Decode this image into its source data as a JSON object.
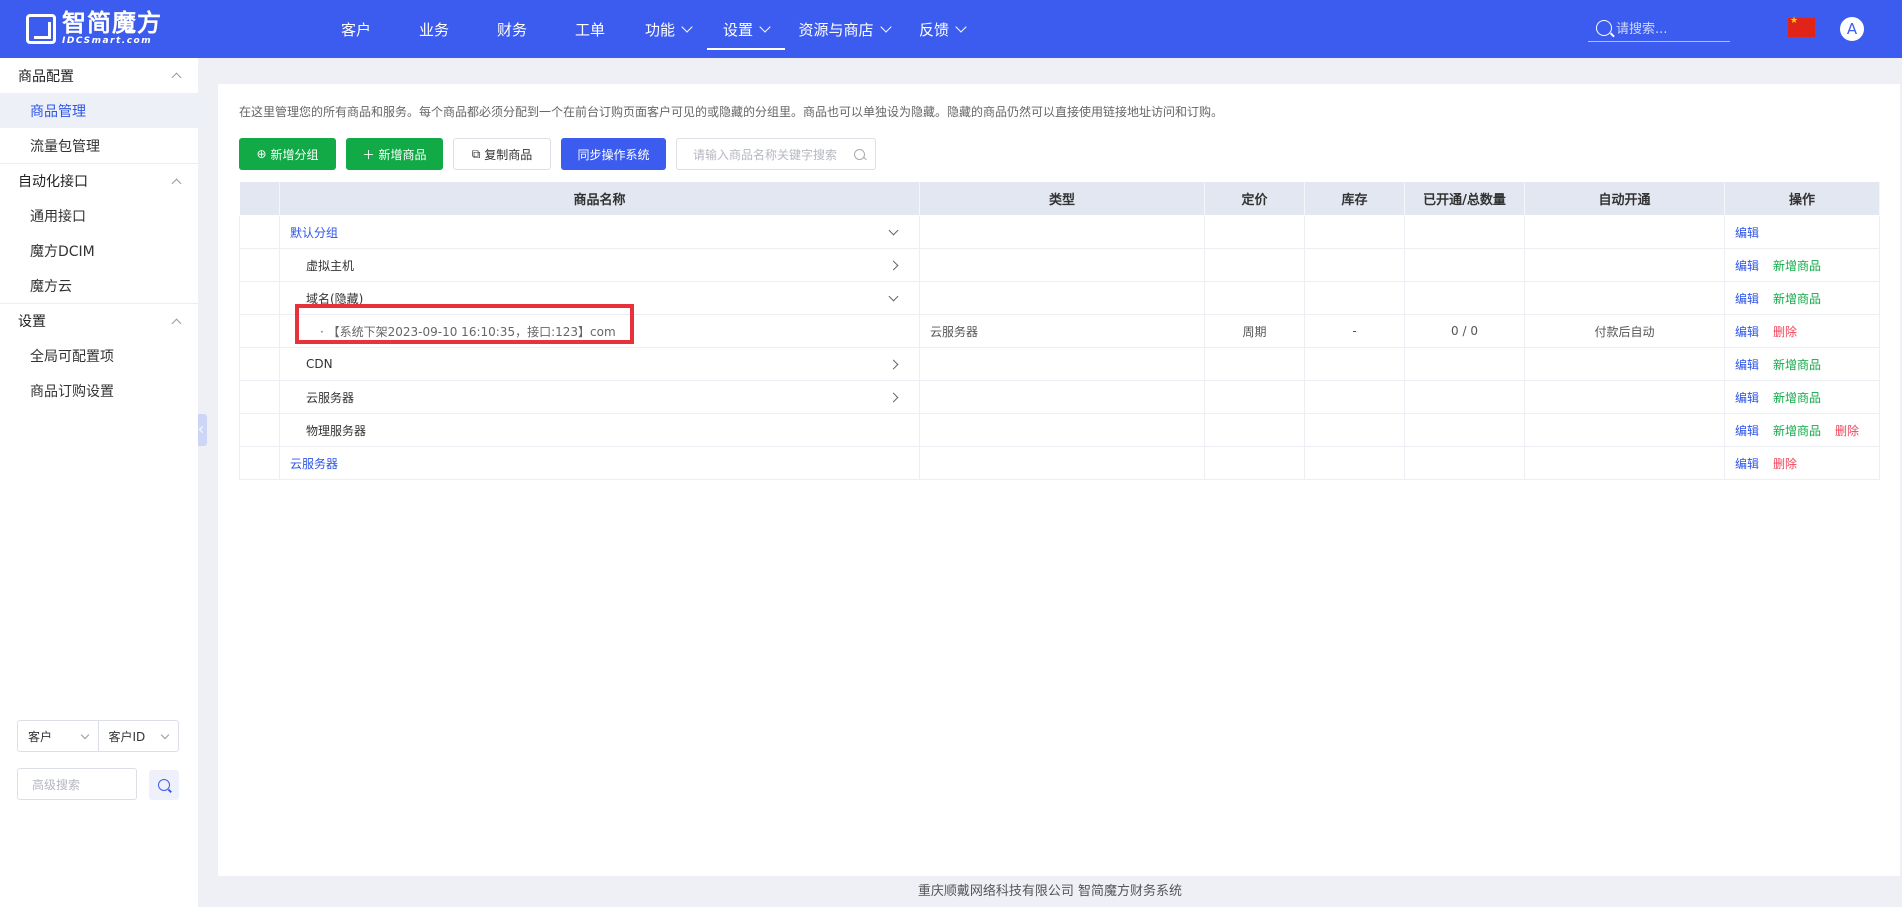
{
  "brand": {
    "name_cn": "智简魔方",
    "name_en": "IDCSmart.com"
  },
  "nav": [
    {
      "label": "客户",
      "has_menu": false,
      "active": false
    },
    {
      "label": "业务",
      "has_menu": false,
      "active": false
    },
    {
      "label": "财务",
      "has_menu": false,
      "active": false
    },
    {
      "label": "工单",
      "has_menu": false,
      "active": false
    },
    {
      "label": "功能",
      "has_menu": true,
      "active": false
    },
    {
      "label": "设置",
      "has_menu": true,
      "active": true
    },
    {
      "label": "资源与商店",
      "has_menu": true,
      "active": false
    },
    {
      "label": "反馈",
      "has_menu": true,
      "active": false
    }
  ],
  "header": {
    "search_placeholder": "请搜索...",
    "avatar_letter": "A",
    "flag": "cn-flag"
  },
  "sidebar": {
    "groups": [
      {
        "title": "商品配置",
        "items": [
          {
            "label": "商品管理",
            "active": true
          },
          {
            "label": "流量包管理",
            "active": false
          }
        ]
      },
      {
        "title": "自动化接口",
        "items": [
          {
            "label": "通用接口",
            "active": false
          },
          {
            "label": "魔方DCIM",
            "active": false
          },
          {
            "label": "魔方云",
            "active": false
          }
        ]
      },
      {
        "title": "设置",
        "items": [
          {
            "label": "全局可配置项",
            "active": false
          },
          {
            "label": "商品订购设置",
            "active": false
          }
        ]
      }
    ],
    "filter_select_1": "客户",
    "filter_select_2": "客户ID",
    "advanced_search_placeholder": "高级搜索"
  },
  "main": {
    "description": "在这里管理您的所有商品和服务。每个商品都必须分配到一个在前台订购页面客户可见的或隐藏的分组里。商品也可以单独设为隐藏。隐藏的商品仍然可以直接使用链接地址访问和订购。",
    "buttons": {
      "add_group": "新增分组",
      "add_product": "新增商品",
      "copy_product": "复制商品",
      "sync_os": "同步操作系统"
    },
    "search_placeholder": "请输入商品名称关键字搜索",
    "columns": [
      "商品名称",
      "类型",
      "定价",
      "库存",
      "已开通/总数量",
      "自动开通",
      "操作"
    ],
    "rows": [
      {
        "name": "默认分组",
        "level": 0,
        "style": "group",
        "arrow": "down",
        "type": "",
        "price": "",
        "stock": "",
        "count": "",
        "auto": "",
        "ops": [
          "编辑"
        ]
      },
      {
        "name": "虚拟主机",
        "level": 1,
        "style": "sub",
        "arrow": "right",
        "type": "",
        "price": "",
        "stock": "",
        "count": "",
        "auto": "",
        "ops": [
          "编辑",
          "新增商品"
        ]
      },
      {
        "name": "域名(隐藏)",
        "level": 1,
        "style": "sub",
        "arrow": "down",
        "type": "",
        "price": "",
        "stock": "",
        "count": "",
        "auto": "",
        "ops": [
          "编辑",
          "新增商品"
        ]
      },
      {
        "name": "· 【系统下架2023-09-10 16:10:35，接口:123】com",
        "level": 2,
        "style": "product",
        "arrow": "",
        "type": "云服务器",
        "price": "周期",
        "stock": "-",
        "count": "0 / 0",
        "auto": "付款后自动",
        "ops": [
          "编辑",
          "删除"
        ]
      },
      {
        "name": "CDN",
        "level": 1,
        "style": "sub",
        "arrow": "right",
        "type": "",
        "price": "",
        "stock": "",
        "count": "",
        "auto": "",
        "ops": [
          "编辑",
          "新增商品"
        ]
      },
      {
        "name": "云服务器",
        "level": 1,
        "style": "sub",
        "arrow": "right",
        "type": "",
        "price": "",
        "stock": "",
        "count": "",
        "auto": "",
        "ops": [
          "编辑",
          "新增商品"
        ]
      },
      {
        "name": "物理服务器",
        "level": 1,
        "style": "sub",
        "arrow": "",
        "type": "",
        "price": "",
        "stock": "",
        "count": "",
        "auto": "",
        "ops": [
          "编辑",
          "新增商品",
          "删除"
        ]
      },
      {
        "name": "云服务器",
        "level": 0,
        "style": "group",
        "arrow": "",
        "type": "",
        "price": "",
        "stock": "",
        "count": "",
        "auto": "",
        "ops": [
          "编辑",
          "删除"
        ]
      }
    ]
  },
  "footer": "重庆顺戴网络科技有限公司 智简魔方财务系统",
  "colors": {
    "primary": "#3c5cf0",
    "success": "#12a947",
    "danger": "#f0445a",
    "highlight": "#e8313a"
  }
}
